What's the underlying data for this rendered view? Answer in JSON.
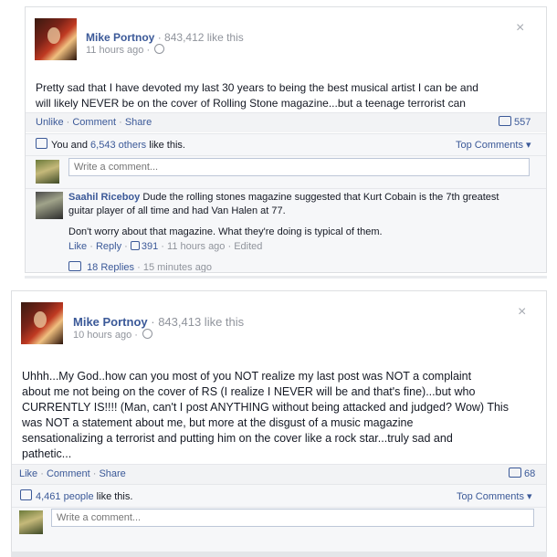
{
  "post1": {
    "author": "Mike Portnoy",
    "like_count_text": "843,412 like this",
    "time": "11 hours ago",
    "body_lines": [
      "Pretty sad that I have devoted my last 30 years to being the best musical artist I can be and",
      "will likely NEVER be on the cover of Rolling Stone magazine...but a teenage terrorist can"
    ],
    "actions": {
      "unlike": "Unlike",
      "comment": "Comment",
      "share": "Share"
    },
    "comment_count": "557",
    "likes_line": {
      "prefix": "You and ",
      "others": "6,543 others",
      "suffix": " like this."
    },
    "top_comments": "Top Comments ▾",
    "comment_placeholder": "Write a comment...",
    "comment": {
      "author": "Saahil Riceboy",
      "text_line1": " Dude the rolling stones magazine suggested that Kurt Cobain is the 7th greatest",
      "text_line2": "guitar player of all time and had Van Halen at 77.",
      "text_line3": "Don't worry about that magazine. What they're doing is typical of them.",
      "like": "Like",
      "reply": "Reply",
      "likes": "391",
      "time": "11 hours ago",
      "edited": "Edited"
    },
    "replies": {
      "count": "18 Replies",
      "time": "15 minutes ago"
    }
  },
  "post2": {
    "author": "Mike Portnoy",
    "like_count_text": "843,413 like this",
    "time": "10 hours ago",
    "body_lines": [
      "Uhhh...My God..how can you most of you NOT realize my last post was NOT a complaint",
      "about me not being on the cover of RS (I realize I NEVER will be and that's fine)...but who",
      "CURRENTLY IS!!!! (Man, can't I post ANYTHING without being attacked and judged? Wow) This",
      "was NOT a statement about me, but more at the disgust of a music magazine",
      "sensationalizing a terrorist and putting him on the cover like a rock star...truly sad and",
      "pathetic..."
    ],
    "actions": {
      "like": "Like",
      "comment": "Comment",
      "share": "Share"
    },
    "comment_count": "68",
    "likes_line": {
      "people": "4,461 people",
      "suffix": " like this."
    },
    "top_comments": "Top Comments ▾",
    "comment_placeholder": "Write a comment..."
  },
  "icons": {
    "close": "×",
    "separator": " · "
  }
}
